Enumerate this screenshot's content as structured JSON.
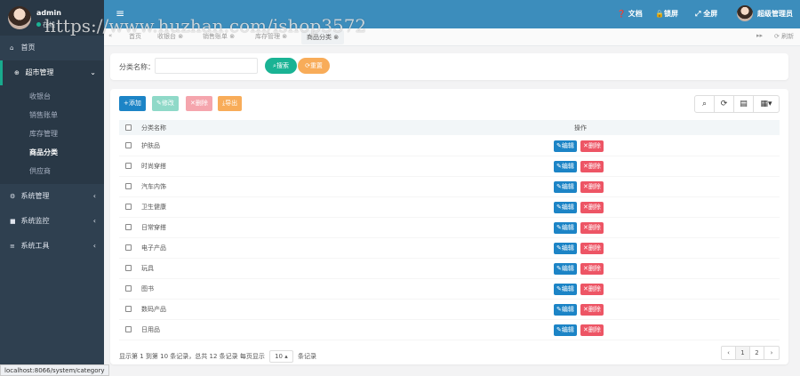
{
  "user": {
    "name": "admin",
    "status": "在线"
  },
  "sidebar": {
    "home": "首页",
    "group_supermarket": "超市管理",
    "items": [
      "收银台",
      "销售账单",
      "库存管理",
      "商品分类",
      "供应商"
    ],
    "group_system_mgmt": "系统管理",
    "group_system_monitor": "系统监控",
    "group_system_tools": "系统工具"
  },
  "topbar": {
    "docs": "文档",
    "lock": "锁屏",
    "fullscreen": "全屏",
    "role": "超级管理员"
  },
  "watermark": "https://www.huzhan.com/ishop3572",
  "tabs": [
    "首页",
    "收银台",
    "销售账单",
    "库存管理",
    "商品分类"
  ],
  "tab_refresh": "刷新",
  "search": {
    "label": "分类名称：",
    "value": "",
    "search_btn": "搜索",
    "reset_btn": "重置"
  },
  "toolbar": {
    "add": "添加",
    "edit": "修改",
    "delete": "删除",
    "export": "导出"
  },
  "table": {
    "headers": [
      "分类名称",
      "操作"
    ],
    "edit_label": "编辑",
    "delete_label": "删除",
    "rows": [
      "护肤品",
      "时尚穿搭",
      "汽车内饰",
      "卫生健康",
      "日常穿搭",
      "电子产品",
      "玩具",
      "图书",
      "数码产品",
      "日用品"
    ]
  },
  "pagination": {
    "info_prefix": "显示第 1 到第 10 条记录，总共 12 条记录",
    "per_page_label": "每页显示",
    "page_size": "10 ▴",
    "per_page_suffix": "条记录",
    "pages": [
      "‹",
      "1",
      "2",
      "›"
    ]
  },
  "status_url": "localhost:8066/system/category",
  "colors": {
    "sidebar": "#2f4050",
    "topbar": "#3c8dbc",
    "primary": "#1c84c6",
    "success": "#1ab394",
    "danger": "#ed5565",
    "warning": "#f8ac59"
  }
}
